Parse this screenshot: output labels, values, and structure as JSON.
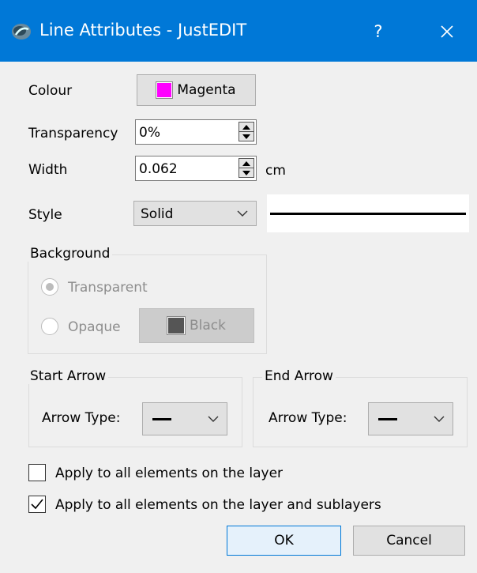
{
  "window": {
    "title": "Line Attributes - JustEDIT",
    "help_label": "?"
  },
  "colour": {
    "label": "Colour",
    "value": "Magenta",
    "swatch": "#ff00ff"
  },
  "transparency": {
    "label": "Transparency",
    "value": "0%"
  },
  "width": {
    "label": "Width",
    "value": "0.062",
    "unit": "cm"
  },
  "style": {
    "label": "Style",
    "value": "Solid"
  },
  "background": {
    "title": "Background",
    "transparent_label": "Transparent",
    "opaque_label": "Opaque",
    "colour_value": "Black",
    "swatch": "#555555"
  },
  "start_arrow": {
    "title": "Start Arrow",
    "type_label": "Arrow Type:"
  },
  "end_arrow": {
    "title": "End Arrow",
    "type_label": "Arrow Type:"
  },
  "options": {
    "apply_layer": "Apply to all elements on the layer",
    "apply_layer_checked": false,
    "apply_sublayers": "Apply to all elements on the layer and sublayers",
    "apply_sublayers_checked": true
  },
  "buttons": {
    "ok": "OK",
    "cancel": "Cancel"
  },
  "colors": {
    "titlebar": "#0078d7",
    "dialog_bg": "#f0f0f0"
  }
}
